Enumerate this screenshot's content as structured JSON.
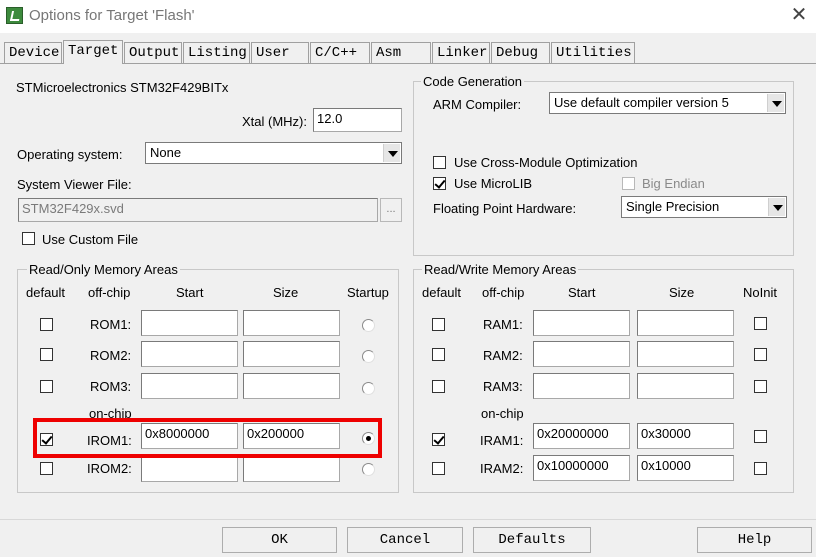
{
  "window": {
    "title": "Options for Target 'Flash'"
  },
  "tabs": [
    "Device",
    "Target",
    "Output",
    "Listing",
    "User",
    "C/C++",
    "Asm",
    "Linker",
    "Debug",
    "Utilities"
  ],
  "active_tab": "Target",
  "device": "STMicroelectronics STM32F429BITx",
  "xtal": {
    "label": "Xtal (MHz):",
    "value": "12.0"
  },
  "os": {
    "label": "Operating system:",
    "value": "None"
  },
  "svf": {
    "label": "System Viewer File:",
    "value": "STM32F429x.svd",
    "browse": "..."
  },
  "custom_file": {
    "label": "Use Custom File",
    "checked": false
  },
  "codegen": {
    "title": "Code Generation",
    "compiler_label": "ARM Compiler:",
    "compiler_value": "Use default compiler version 5",
    "cross_module": "Use Cross-Module Optimization",
    "microlib": "Use MicroLIB",
    "big_endian": "Big Endian",
    "fph_label": "Floating Point Hardware:",
    "fph_value": "Single Precision"
  },
  "rom": {
    "title": "Read/Only Memory Areas",
    "headers": {
      "default": "default",
      "offchip": "off-chip",
      "start": "Start",
      "size": "Size",
      "startup": "Startup"
    },
    "onchip": "on-chip",
    "rows": [
      {
        "name": "ROM1:",
        "start": "",
        "size": "",
        "default": false,
        "startup": false
      },
      {
        "name": "ROM2:",
        "start": "",
        "size": "",
        "default": false,
        "startup": false
      },
      {
        "name": "ROM3:",
        "start": "",
        "size": "",
        "default": false,
        "startup": false
      },
      {
        "name": "IROM1:",
        "start": "0x8000000",
        "size": "0x200000",
        "default": true,
        "startup": true
      },
      {
        "name": "IROM2:",
        "start": "",
        "size": "",
        "default": false,
        "startup": false
      }
    ]
  },
  "ram": {
    "title": "Read/Write Memory Areas",
    "headers": {
      "default": "default",
      "offchip": "off-chip",
      "start": "Start",
      "size": "Size",
      "noinit": "NoInit"
    },
    "onchip": "on-chip",
    "rows": [
      {
        "name": "RAM1:",
        "start": "",
        "size": ""
      },
      {
        "name": "RAM2:",
        "start": "",
        "size": ""
      },
      {
        "name": "RAM3:",
        "start": "",
        "size": ""
      },
      {
        "name": "IRAM1:",
        "start": "0x20000000",
        "size": "0x30000",
        "default": true
      },
      {
        "name": "IRAM2:",
        "start": "0x10000000",
        "size": "0x10000",
        "default": false
      }
    ]
  },
  "buttons": {
    "ok": "OK",
    "cancel": "Cancel",
    "defaults": "Defaults",
    "help": "Help"
  },
  "colors": {
    "highlight": "#e00000"
  }
}
